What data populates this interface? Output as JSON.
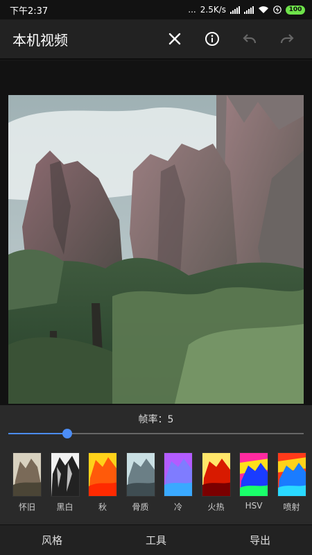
{
  "status_bar": {
    "time": "下午2:37",
    "net_speed": "2.5K/s",
    "dots": "...",
    "battery": "100"
  },
  "app_bar": {
    "title": "本机视频",
    "icons": [
      "close-icon",
      "info-icon",
      "undo-icon",
      "redo-icon"
    ]
  },
  "player": {
    "framerate_label": "帧率：5",
    "framerate_slider_fraction": 0.2
  },
  "filters": [
    {
      "label": "怀旧",
      "style": "sepia"
    },
    {
      "label": "黑白",
      "style": "bw"
    },
    {
      "label": "秋",
      "style": "autumn"
    },
    {
      "label": "骨质",
      "style": "bone"
    },
    {
      "label": "冷",
      "style": "cool"
    },
    {
      "label": "火热",
      "style": "hot"
    },
    {
      "label": "HSV",
      "style": "hsv"
    },
    {
      "label": "喷射",
      "style": "jet"
    }
  ],
  "bottom_nav": {
    "style": "风格",
    "tools": "工具",
    "export": "导出"
  },
  "colors": {
    "accent": "#4c8df6",
    "battery": "#6ee34a"
  }
}
